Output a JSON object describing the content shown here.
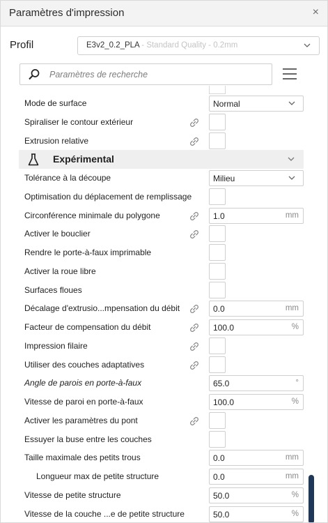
{
  "window": {
    "title": "Paramètres d'impression",
    "close_glyph": "×"
  },
  "profile": {
    "label": "Profil",
    "name": "E3v2_0.2_PLA",
    "subtitle": " - Standard Quality - 0.2mm"
  },
  "search": {
    "placeholder": "Paramètres de recherche"
  },
  "category": {
    "label": "Expérimental",
    "icon": "flask-icon"
  },
  "colors": {
    "accent": "#1f3759",
    "category_bg": "#efefef",
    "border": "#cfcfcf"
  },
  "settings_top": [
    {
      "label": "Mode de surface",
      "type": "dropdown",
      "value": "Normal"
    },
    {
      "label": "Spiraliser le contour extérieur",
      "type": "checkbox",
      "linked": true
    },
    {
      "label": "Extrusion relative",
      "type": "checkbox",
      "linked": true
    }
  ],
  "settings": [
    {
      "label": "Tolérance à la découpe",
      "type": "dropdown",
      "value": "Milieu"
    },
    {
      "label": "Optimisation du déplacement de remplissage",
      "type": "checkbox"
    },
    {
      "label": "Circonférence minimale du polygone",
      "type": "number",
      "value": "1.0",
      "unit": "mm",
      "linked": true
    },
    {
      "label": "Activer le bouclier",
      "type": "checkbox",
      "linked": true
    },
    {
      "label": "Rendre le porte-à-faux imprimable",
      "type": "checkbox"
    },
    {
      "label": "Activer la roue libre",
      "type": "checkbox"
    },
    {
      "label": "Surfaces floues",
      "type": "checkbox"
    },
    {
      "label": "Décalage d'extrusio...mpensation du débit",
      "type": "number",
      "value": "0.0",
      "unit": "mm",
      "linked": true
    },
    {
      "label": "Facteur de compensation du débit",
      "type": "number",
      "value": "100.0",
      "unit": "%",
      "linked": true
    },
    {
      "label": "Impression filaire",
      "type": "checkbox",
      "linked": true
    },
    {
      "label": "Utiliser des couches adaptatives",
      "type": "checkbox",
      "linked": true
    },
    {
      "label": "Angle de parois en porte-à-faux",
      "type": "number",
      "value": "65.0",
      "unit": "°",
      "italic": true
    },
    {
      "label": "Vitesse de paroi en porte-à-faux",
      "type": "number",
      "value": "100.0",
      "unit": "%"
    },
    {
      "label": "Activer les paramètres du pont",
      "type": "checkbox",
      "linked": true
    },
    {
      "label": "Essuyer la buse entre les couches",
      "type": "checkbox"
    },
    {
      "label": "Taille maximale des petits trous",
      "type": "number",
      "value": "0.0",
      "unit": "mm"
    },
    {
      "label": "Longueur max de petite structure",
      "type": "number",
      "value": "0.0",
      "unit": "mm",
      "indent": true
    },
    {
      "label": "Vitesse de petite structure",
      "type": "number",
      "value": "50.0",
      "unit": "%"
    },
    {
      "label": "Vitesse de la couche ...e de petite structure",
      "type": "number",
      "value": "50.0",
      "unit": "%"
    }
  ]
}
